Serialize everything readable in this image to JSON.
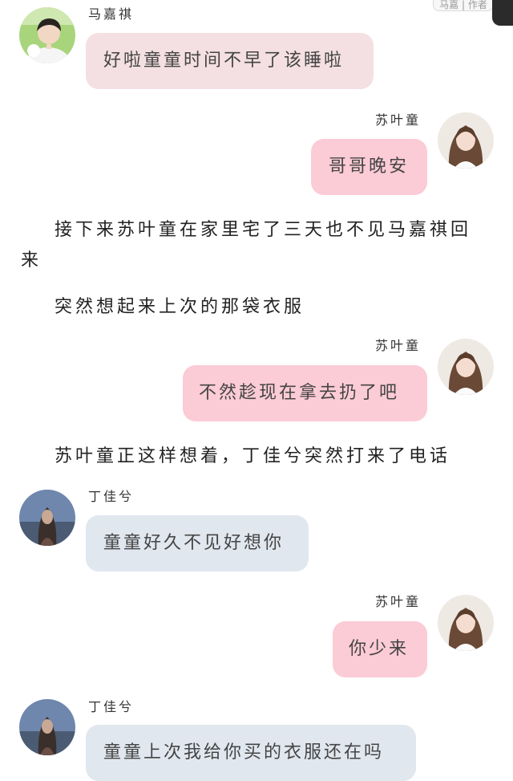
{
  "top_partial": "马嘉 | 作者",
  "senders": {
    "ma": "马嘉祺",
    "su": "苏叶童",
    "ding": "丁佳兮"
  },
  "messages": [
    "好啦童童时间不早了该睡啦",
    "哥哥晚安",
    "不然趁现在拿去扔了吧",
    "童童好久不见好想你",
    "你少来",
    "童童上次我给你买的衣服还在吗"
  ],
  "narration": [
    "接下来苏叶童在家里宅了三天也不见马嘉祺回",
    "来",
    "突然想起来上次的那袋衣服",
    "苏叶童正这样想着，丁佳兮突然打来了电话"
  ],
  "colors": {
    "bubble_ma": "#f4dfe2",
    "bubble_su": "#fbcbd6",
    "bubble_ding": "#e1e7ef"
  }
}
